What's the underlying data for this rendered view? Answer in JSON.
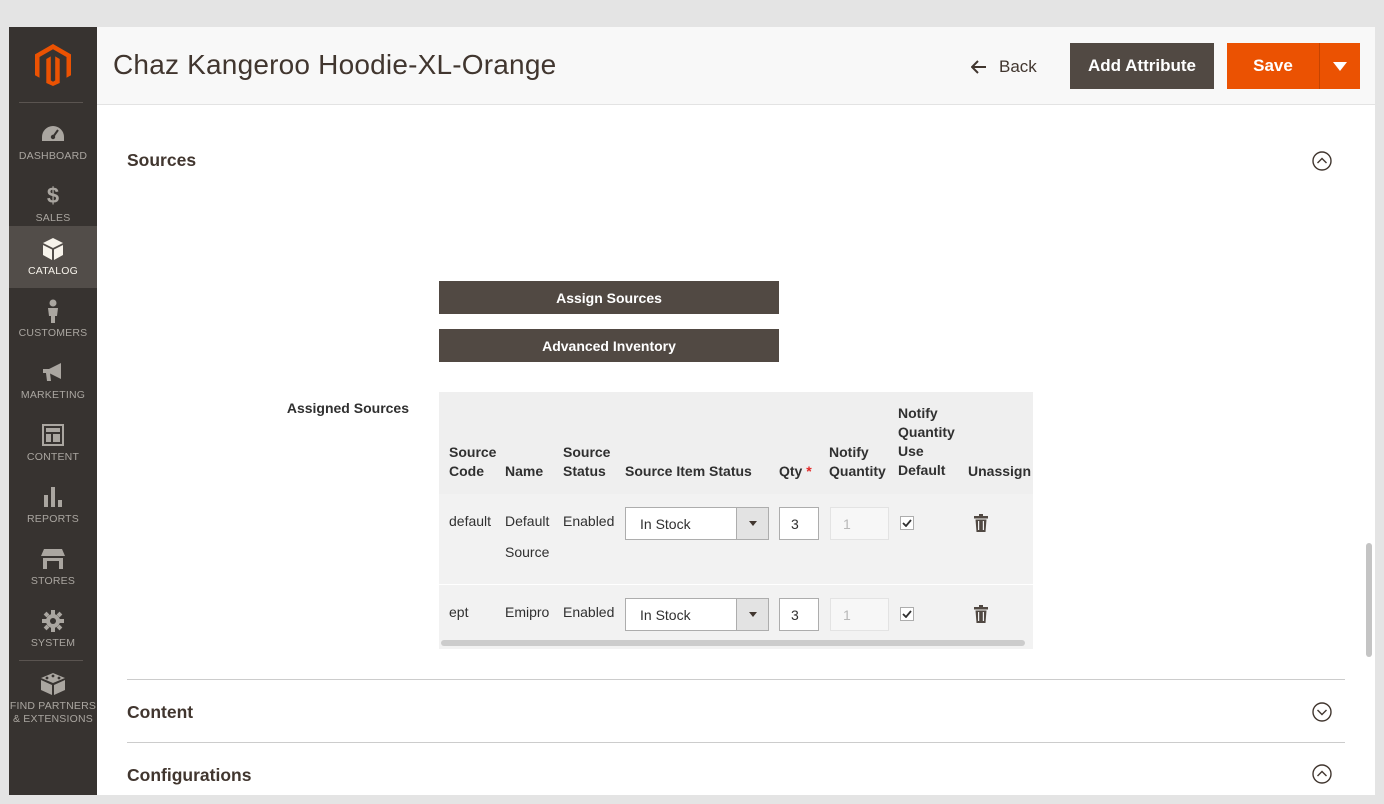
{
  "app": {
    "brand_color": "#eb5202",
    "sidebar_color": "#373330"
  },
  "sidebar": {
    "logo_icon": "magento-logo-icon",
    "items": [
      {
        "label": "DASHBOARD",
        "icon": "speedometer-icon",
        "active": false
      },
      {
        "label": "SALES",
        "icon": "dollar-icon",
        "active": false
      },
      {
        "label": "CATALOG",
        "icon": "box-icon",
        "active": true
      },
      {
        "label": "CUSTOMERS",
        "icon": "person-icon",
        "active": false
      },
      {
        "label": "MARKETING",
        "icon": "megaphone-icon",
        "active": false
      },
      {
        "label": "CONTENT",
        "icon": "layout-icon",
        "active": false
      },
      {
        "label": "REPORTS",
        "icon": "bar-chart-icon",
        "active": false
      },
      {
        "label": "STORES",
        "icon": "storefront-icon",
        "active": false
      },
      {
        "label": "SYSTEM",
        "icon": "gear-icon",
        "active": false
      },
      {
        "label_line1": "FIND PARTNERS",
        "label_line2": "& EXTENSIONS",
        "icon": "blocks-icon",
        "active": false
      }
    ]
  },
  "header": {
    "title": "Chaz Kangeroo Hoodie-XL-Orange",
    "back_label": "Back",
    "add_attribute_label": "Add Attribute",
    "save_label": "Save"
  },
  "sources_section": {
    "title": "Sources",
    "assign_sources_label": "Assign Sources",
    "advanced_inventory_label": "Advanced Inventory",
    "assigned_sources_label": "Assigned Sources",
    "columns": {
      "source_code_1": "Source",
      "source_code_2": "Code",
      "name": "Name",
      "source_status_1": "Source",
      "source_status_2": "Status",
      "source_item_status": "Source Item Status",
      "qty": "Qty",
      "qty_required_mark": "*",
      "notify_qty_1": "Notify",
      "notify_qty_2": "Quantity",
      "notify_default_1": "Notify",
      "notify_default_2": "Quantity",
      "notify_default_3": "Use",
      "notify_default_4": "Default",
      "unassign": "Unassign"
    },
    "rows": [
      {
        "code": "default",
        "name_1": "Default",
        "name_2": "Source",
        "status": "Enabled",
        "item_status": "In Stock",
        "qty": "3",
        "notify_qty": "1",
        "use_default": true
      },
      {
        "code": "ept",
        "name_1": "Emipro",
        "name_2": "",
        "status": "Enabled",
        "item_status": "In Stock",
        "qty": "3",
        "notify_qty": "1",
        "use_default": true
      }
    ]
  },
  "content_section": {
    "title": "Content"
  },
  "configurations_section": {
    "title": "Configurations"
  }
}
